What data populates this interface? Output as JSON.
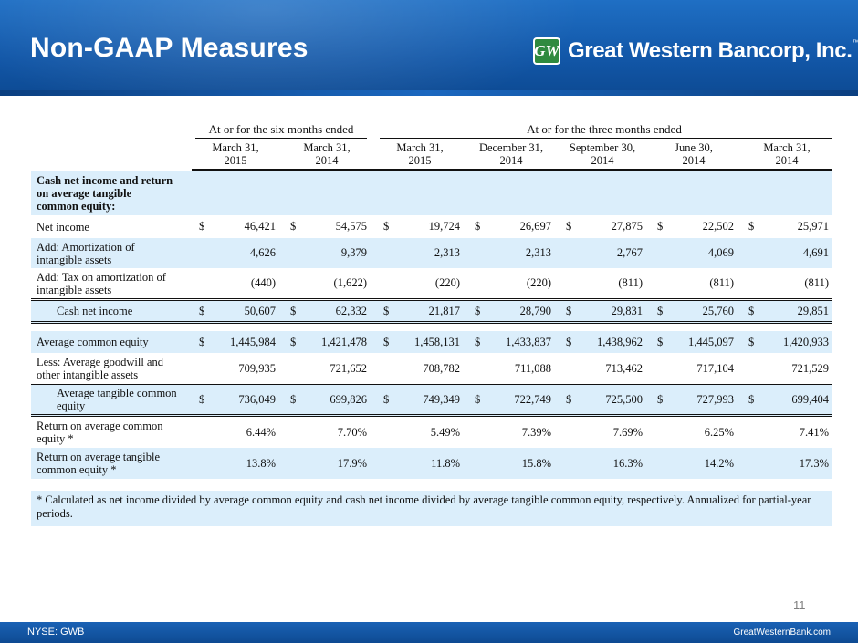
{
  "slide": {
    "title": "Non-GAAP Measures",
    "page_number": "11",
    "footer_left": "NYSE: GWB",
    "footer_right": "GreatWesternBank.com"
  },
  "logo": {
    "text": "Great Western Bancorp, Inc.",
    "tm": "™",
    "mark": "GW"
  },
  "colors": {
    "header_blue": "#1257a8",
    "row_shade": "#dbeefb",
    "logo_green": "#2f8a3f"
  },
  "table": {
    "group_six": "At or for the six months ended",
    "group_three": "At or for the three months ended",
    "columns": [
      "March 31,\n2015",
      "March 31,\n2014",
      "March 31,\n2015",
      "December 31,\n2014",
      "September 30,\n2014",
      "June 30,\n2014",
      "March 31,\n2014"
    ],
    "section_label": "Cash net income and return\non average tangible\ncommon equity:",
    "rows": [
      {
        "label": "Net income",
        "dollar": "$",
        "values": [
          "46,421",
          "54,575",
          "19,724",
          "26,697",
          "27,875",
          "22,502",
          "25,971"
        ]
      },
      {
        "label": "Add: Amortization of\nintangible assets",
        "dollar": "",
        "values": [
          "4,626",
          "9,379",
          "2,313",
          "2,313",
          "2,767",
          "4,069",
          "4,691"
        ]
      },
      {
        "label": "Add: Tax on amortization of\nintangible assets",
        "dollar": "",
        "values": [
          "(440)",
          "(1,622)",
          "(220)",
          "(220)",
          "(811)",
          "(811)",
          "(811)"
        ]
      },
      {
        "label": "Cash net income",
        "dollar": "$",
        "values": [
          "50,607",
          "62,332",
          "21,817",
          "28,790",
          "29,831",
          "25,760",
          "29,851"
        ]
      },
      {
        "label": "Average common equity",
        "dollar": "$",
        "values": [
          "1,445,984",
          "1,421,478",
          "1,458,131",
          "1,433,837",
          "1,438,962",
          "1,445,097",
          "1,420,933"
        ]
      },
      {
        "label": "Less: Average goodwill and\nother intangible assets",
        "dollar": "",
        "values": [
          "709,935",
          "721,652",
          "708,782",
          "711,088",
          "713,462",
          "717,104",
          "721,529"
        ]
      },
      {
        "label": "Average tangible common\nequity",
        "dollar": "$",
        "values": [
          "736,049",
          "699,826",
          "749,349",
          "722,749",
          "725,500",
          "727,993",
          "699,404"
        ]
      },
      {
        "label": "Return on average common\nequity *",
        "dollar": "",
        "values": [
          "6.44%",
          "7.70%",
          "5.49%",
          "7.39%",
          "7.69%",
          "6.25%",
          "7.41%"
        ]
      },
      {
        "label": "Return on average tangible\ncommon equity *",
        "dollar": "",
        "values": [
          "13.8%",
          "17.9%",
          "11.8%",
          "15.8%",
          "16.3%",
          "14.2%",
          "17.3%"
        ]
      }
    ],
    "footnote": "* Calculated as net income divided by average common equity and cash net income divided by average tangible common equity, respectively.  Annualized for partial-year periods."
  }
}
